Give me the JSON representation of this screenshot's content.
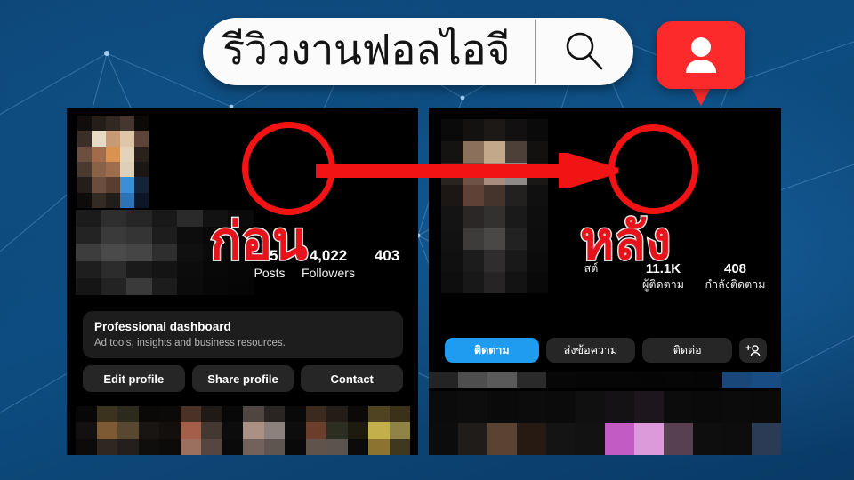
{
  "theme": {
    "background_blue": "#0d4877",
    "accent_red": "#f21414",
    "notification_red": "#fc2a2a",
    "follow_blue": "#1f9bf0",
    "panel_black": "#000000"
  },
  "search": {
    "query": "รีวิวงานฟอลไอจี",
    "icon": "search-icon"
  },
  "notification_badge": {
    "icon": "person-follower-icon",
    "color": "#fc2a2a"
  },
  "annotations": {
    "before_label": "ก่อน",
    "after_label": "หลัง",
    "arrow": "right-arrow",
    "highlight_left": "followers-count-circle",
    "highlight_right": "followers-count-circle"
  },
  "left_panel": {
    "stats": [
      {
        "num": "75",
        "label": "Posts"
      },
      {
        "num": "4,022",
        "label": "Followers"
      },
      {
        "num": "403",
        "label": ""
      }
    ],
    "dashboard": {
      "title": "Professional dashboard",
      "subtitle": "Ad tools, insights and business resources."
    },
    "buttons": [
      {
        "label": "Edit profile"
      },
      {
        "label": "Share profile"
      },
      {
        "label": "Contact"
      }
    ]
  },
  "right_panel": {
    "stats": [
      {
        "num": "",
        "label": "สต์"
      },
      {
        "num": "11.1K",
        "label": "ผู้ติดตาม"
      },
      {
        "num": "408",
        "label": "กำลังติดตาม"
      }
    ],
    "buttons": [
      {
        "label": "ติดตาม",
        "style": "primary"
      },
      {
        "label": "ส่งข้อความ",
        "style": "ghost"
      },
      {
        "label": "ติดต่อ",
        "style": "ghost"
      },
      {
        "label": "",
        "style": "icon",
        "icon": "add-person-icon"
      }
    ]
  }
}
